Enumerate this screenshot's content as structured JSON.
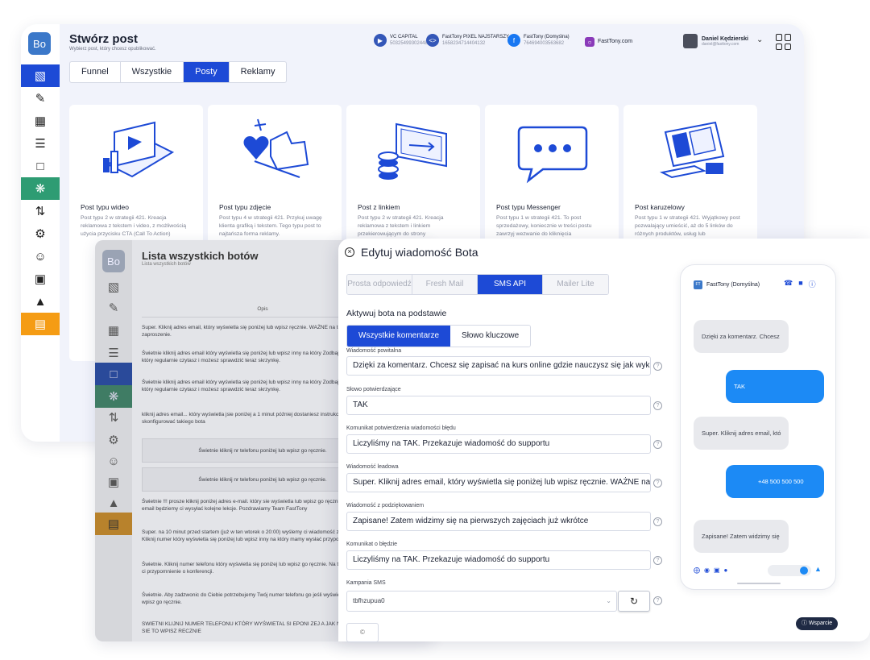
{
  "back": {
    "logo": "Bo",
    "title": "Stwórz post",
    "subtitle": "Wybierz post, który chcesz opublikować.",
    "accounts": [
      {
        "name": "VC CAPITAL",
        "id": "503254993024489",
        "icon": "video-camera-icon",
        "color": "#3457b8"
      },
      {
        "name": "FastTony PIXEL NAJSTARSZY",
        "id": "1658234714404132",
        "icon": "code-icon",
        "color": "#3457b8"
      },
      {
        "name": "FastTony (Domyślna)",
        "id": "764694003563682",
        "icon": "facebook-icon",
        "color": "#1877f2"
      },
      {
        "name": "FastTony.com",
        "id": "",
        "icon": "instagram-icon",
        "color": "#8a3ab9"
      }
    ],
    "user": {
      "name": "Daniel Kędzierski",
      "email": "daniel@fasttony.com"
    },
    "tabs": [
      {
        "label": "Funnel",
        "active": false
      },
      {
        "label": "Wszystkie",
        "active": false
      },
      {
        "label": "Posty",
        "active": true
      },
      {
        "label": "Reklamy",
        "active": false
      }
    ],
    "cards": [
      {
        "title": "Post typu wideo",
        "desc": "Post typu 2 w strategii 421. Kreacja reklamowa z tekstem i video, z możliwością użycia przycisku CTA (Call To Action)",
        "art": "video-illustration"
      },
      {
        "title": "Post typu zdjęcie",
        "desc": "Post typu 4 w strategii 421. Przykuj uwagę klienta grafiką i tekstem. Tego typu post to najtańsza forma reklamy.",
        "art": "photo-like-illustration"
      },
      {
        "title": "Post z linkiem",
        "desc": "Post typu 2 w strategii 421. Kreacja reklamowa z tekstem i linkiem przekierowującym do strony",
        "art": "link-monitor-illustration"
      },
      {
        "title": "Post typu Messenger",
        "desc": "Post typu 1 w strategii 421. To post sprzedażowy, koniecznie w treści postu zawrzyj wezwanie do kliknięcia",
        "art": "messenger-chat-illustration"
      },
      {
        "title": "Post karuzelowy",
        "desc": "Post typu 1 w strategii 421. Wyjątkowy post pozwalający umieścić, aż do 5 linków do różnych produktów, usług lub",
        "art": "carousel-illustration"
      }
    ]
  },
  "middle": {
    "logo": "Bo",
    "title": "Lista wszystkich botów",
    "subtitle": "Lista wszystkich botów",
    "column_header": "Opis",
    "rows": [
      "Super. Kliknij adres email, który wyświetla się poniżej lub wpisz ręcznie. WAŻNE na ten mail przyjdzie zaproszenie.",
      "Świetnie kliknij adres email który wyświetla się poniżej lub wpisz inny na który Zodbaj by to był adres który regularnie czytasz i możesz sprawdzić teraz skrzynkę.",
      "Świetnie kliknij adres email który wyświetla się poniżej lub wpisz inny na który Zodbaj by to był adres który regularnie czytasz i możesz sprawdzić teraz skrzynkę.",
      "kliknij adres email... który wyświetla jsie poniżej a 1 minut później dostaniesz instrukcje jak skonfigurować takiego bota",
      "Świetnie kliknij nr telefonu poniżej lub wpisz go ręcznie.",
      "Świetnie kliknij nr telefonu poniżej lub wpisz go ręcznie.",
      "Świetnie !!! prosze kliknij poniżej adres e-mail. który sie wyświetla lub wpisz go ręcznie. Na ten adres email będziemy ci wysyłać kolejne lekcje. Pozdrawiamy Team FastTony",
      "Super. na 10 minut przed startem (już w ten wtorek o 20:00) wyślemy ci wiadomość z przypomnieniem. Kliknij numer który wyświetla się poniżej lub wpisz inny na który mamy wysłać przypomnienie",
      "Świetnie. Kliknij numer telefonu który wyświetla się poniżej lub wpisz go ręcznie. Na ten numer wyślemy ci przypomnienie o konferencji.",
      "Świetnie. Aby zadzwonic do Ciebie potrzebujemy Twój numer telefonu go jeśli wyświetla się poniżej lub wpisz go ręcznie.",
      "SWIETNI KLIJNIJ NUMER TELEFONU KTÓRY WYŚWIETAL SI EPONI ZEJ A JAK NIE WYŚWIETAL SIE TO WPISZ RECZNIE"
    ]
  },
  "dialog": {
    "title": "Edytuj wiadomość Bota",
    "providers": [
      {
        "label": "Prosta odpowiedź",
        "active": false
      },
      {
        "label": "Fresh Mail",
        "active": false
      },
      {
        "label": "SMS API",
        "active": true
      },
      {
        "label": "Mailer Lite",
        "active": false
      }
    ],
    "activate_label": "Aktywuj bota na podstawie",
    "trigger": [
      {
        "label": "Wszystkie komentarze",
        "active": true
      },
      {
        "label": "Słowo kluczowe",
        "active": false
      }
    ],
    "fields": [
      {
        "label": "Wiadomość powitalna",
        "value": "Dzięki za komentarz. Chcesz się zapisać na kurs online gdzie nauczysz się jak wykorzystać"
      },
      {
        "label": "Słowo potwierdzające",
        "value": "TAK"
      },
      {
        "label": "Komunikat potwierdzenia wiadomości błędu",
        "value": "Liczyliśmy na TAK. Przekazuje wiadomość do supportu"
      },
      {
        "label": "Wiadomość leadowa",
        "value": "Super. Kliknij adres email, który wyświetla się poniżej lub wpisz ręcznie. WAŻNE na ten mail"
      },
      {
        "label": "Wiadomość z podziękowaniem",
        "value": "Zapisane! Zatem widzimy się na pierwszych zajęciach już wkrótce"
      },
      {
        "label": "Komunikat o błędzie",
        "value": "Liczyliśmy na TAK. Przekazuje wiadomość do supportu"
      }
    ],
    "campaign_label": "Kampania SMS",
    "campaign_value": "tbfhzupua0",
    "small_button": "©"
  },
  "phone": {
    "page_name": "FastTony (Domyślna)",
    "logo": "FT",
    "messages": [
      {
        "dir": "in",
        "text": "Dzięki za komentarz. Chcesz"
      },
      {
        "dir": "out",
        "text": "TAK"
      },
      {
        "dir": "in",
        "text": "Super. Kliknij adres email, któ"
      },
      {
        "dir": "out",
        "text": "+48 500 500 500"
      },
      {
        "dir": "in",
        "text": "Zapisane! Zatem widzimy się"
      }
    ]
  },
  "support_label": "Wsparcie"
}
